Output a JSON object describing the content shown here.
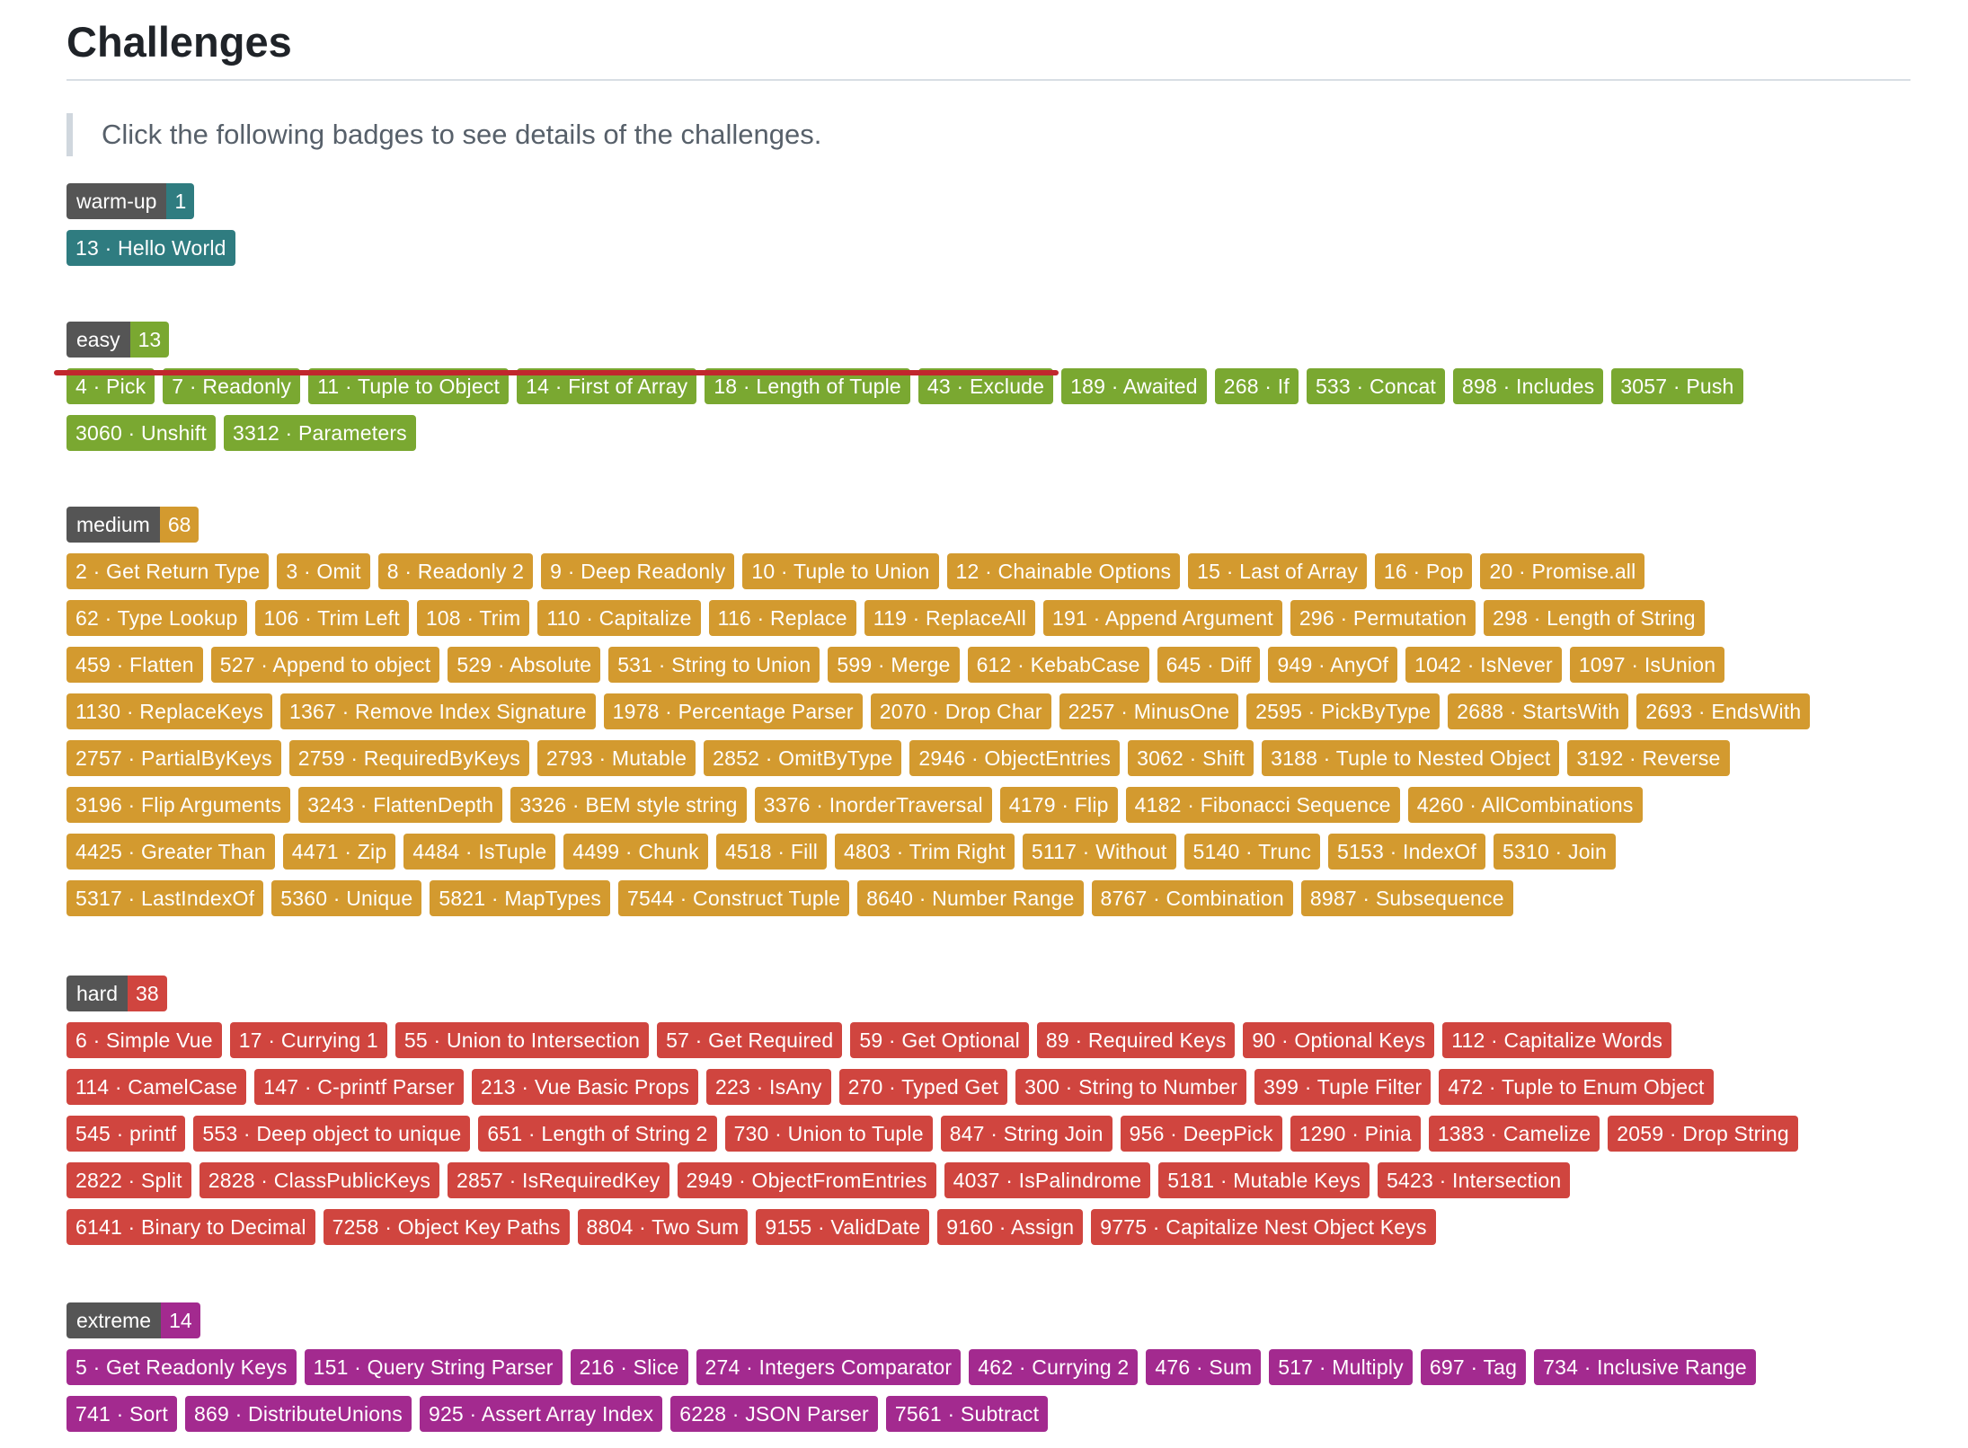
{
  "title": "Challenges",
  "description": "Click the following badges to see details of the challenges.",
  "colors": {
    "label_bg": "#555555",
    "warm-up": "#2f7c80",
    "easy": "#7aa831",
    "medium": "#d39a2f",
    "hard": "#d0453f",
    "extreme": "#a32a8f",
    "strike": "#c1272d"
  },
  "sections": [
    {
      "key": "warm-up",
      "label": "warm-up",
      "count": "1",
      "rows": [
        [
          "13 · Hello World"
        ]
      ]
    },
    {
      "key": "easy",
      "label": "easy",
      "count": "13",
      "rows": [
        [
          "4 · Pick",
          "7 · Readonly",
          "11 · Tuple to Object",
          "14 · First of Array",
          "18 · Length of Tuple",
          "43 · Exclude",
          "189 · Awaited",
          "268 · If",
          "533 · Concat",
          "898 · Includes",
          "3057 · Push"
        ],
        [
          "3060 · Unshift",
          "3312 · Parameters"
        ]
      ]
    },
    {
      "key": "medium",
      "label": "medium",
      "count": "68",
      "rows": [
        [
          "2 · Get Return Type",
          "3 · Omit",
          "8 · Readonly 2",
          "9 · Deep Readonly",
          "10 · Tuple to Union",
          "12 · Chainable Options",
          "15 · Last of Array",
          "16 · Pop",
          "20 · Promise.all"
        ],
        [
          "62 · Type Lookup",
          "106 · Trim Left",
          "108 · Trim",
          "110 · Capitalize",
          "116 · Replace",
          "119 · ReplaceAll",
          "191 · Append Argument",
          "296 · Permutation",
          "298 · Length of String"
        ],
        [
          "459 · Flatten",
          "527 · Append to object",
          "529 · Absolute",
          "531 · String to Union",
          "599 · Merge",
          "612 · KebabCase",
          "645 · Diff",
          "949 · AnyOf",
          "1042 · IsNever",
          "1097 · IsUnion"
        ],
        [
          "1130 · ReplaceKeys",
          "1367 · Remove Index Signature",
          "1978 · Percentage Parser",
          "2070 · Drop Char",
          "2257 · MinusOne",
          "2595 · PickByType",
          "2688 · StartsWith",
          "2693 · EndsWith"
        ],
        [
          "2757 · PartialByKeys",
          "2759 · RequiredByKeys",
          "2793 · Mutable",
          "2852 · OmitByType",
          "2946 · ObjectEntries",
          "3062 · Shift",
          "3188 · Tuple to Nested Object",
          "3192 · Reverse"
        ],
        [
          "3196 · Flip Arguments",
          "3243 · FlattenDepth",
          "3326 · BEM style string",
          "3376 · InorderTraversal",
          "4179 · Flip",
          "4182 · Fibonacci Sequence",
          "4260 · AllCombinations"
        ],
        [
          "4425 · Greater Than",
          "4471 · Zip",
          "4484 · IsTuple",
          "4499 · Chunk",
          "4518 · Fill",
          "4803 · Trim Right",
          "5117 · Without",
          "5140 · Trunc",
          "5153 · IndexOf",
          "5310 · Join"
        ],
        [
          "5317 · LastIndexOf",
          "5360 · Unique",
          "5821 · MapTypes",
          "7544 · Construct Tuple",
          "8640 · Number Range",
          "8767 · Combination",
          "8987 · Subsequence"
        ]
      ]
    },
    {
      "key": "hard",
      "label": "hard",
      "count": "38",
      "rows": [
        [
          "6 · Simple Vue",
          "17 · Currying 1",
          "55 · Union to Intersection",
          "57 · Get Required",
          "59 · Get Optional",
          "89 · Required Keys",
          "90 · Optional Keys",
          "112 · Capitalize Words"
        ],
        [
          "114 · CamelCase",
          "147 · C-printf Parser",
          "213 · Vue Basic Props",
          "223 · IsAny",
          "270 · Typed Get",
          "300 · String to Number",
          "399 · Tuple Filter",
          "472 · Tuple to Enum Object"
        ],
        [
          "545 · printf",
          "553 · Deep object to unique",
          "651 · Length of String 2",
          "730 · Union to Tuple",
          "847 · String Join",
          "956 · DeepPick",
          "1290 · Pinia",
          "1383 · Camelize",
          "2059 · Drop String"
        ],
        [
          "2822 · Split",
          "2828 · ClassPublicKeys",
          "2857 · IsRequiredKey",
          "2949 · ObjectFromEntries",
          "4037 · IsPalindrome",
          "5181 · Mutable Keys",
          "5423 · Intersection"
        ],
        [
          "6141 · Binary to Decimal",
          "7258 · Object Key Paths",
          "8804 · Two Sum",
          "9155 · ValidDate",
          "9160 · Assign",
          "9775 · Capitalize Nest Object Keys"
        ]
      ]
    },
    {
      "key": "extreme",
      "label": "extreme",
      "count": "14",
      "rows": [
        [
          "5 · Get Readonly Keys",
          "151 · Query String Parser",
          "216 · Slice",
          "274 · Integers Comparator",
          "462 · Currying 2",
          "476 · Sum",
          "517 · Multiply",
          "697 · Tag",
          "734 · Inclusive Range"
        ],
        [
          "741 · Sort",
          "869 · DistributeUnions",
          "925 · Assert Array Index",
          "6228 · JSON Parser",
          "7561 · Subtract"
        ]
      ]
    }
  ]
}
